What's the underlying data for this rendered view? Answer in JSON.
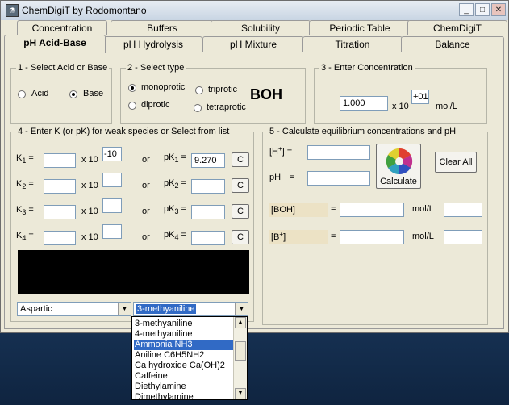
{
  "window": {
    "title": "ChemDigiT by Rodomontano",
    "icon": "app-icon",
    "minimize": "_",
    "maximize": "□",
    "close": "✕"
  },
  "tabs_row1": [
    "Concentration",
    "Buffers",
    "Solubility",
    "Periodic Table",
    "ChemDigiT"
  ],
  "tabs_row2": [
    "pH Acid-Base",
    "pH Hydrolysis",
    "pH Mixture",
    "Titration",
    "Balance"
  ],
  "active_tab": "pH Acid-Base",
  "group1": {
    "title": "1 - Select Acid or Base",
    "acid": "Acid",
    "base": "Base",
    "selected": "Base"
  },
  "group2": {
    "title": "2 - Select type",
    "monoprotic": "monoprotic",
    "triprotic": "triprotic",
    "diprotic": "diprotic",
    "tetraprotic": "tetraprotic",
    "selected": "monoprotic",
    "formula": "BOH"
  },
  "group3": {
    "title": "3 - Enter Concentration",
    "mantissa": "1.000",
    "times10": "x 10",
    "exponent": "+01",
    "unit": "mol/L"
  },
  "group4": {
    "title": "4 - Enter K (or pK) for weak species or Select from list",
    "rows": [
      {
        "k": "K",
        "ksub": "1",
        "eq": "=",
        "times10": "x 10",
        "exp": "-10",
        "or": "or",
        "pk": "pK",
        "pksub": "1",
        "pkval": "9.270",
        "c": "C"
      },
      {
        "k": "K",
        "ksub": "2",
        "eq": "=",
        "times10": "x 10",
        "exp": "",
        "or": "or",
        "pk": "pK",
        "pksub": "2",
        "pkval": "",
        "c": "C"
      },
      {
        "k": "K",
        "ksub": "3",
        "eq": "=",
        "times10": "x 10",
        "exp": "",
        "or": "or",
        "pk": "pK",
        "pksub": "3",
        "pkval": "",
        "c": "C"
      },
      {
        "k": "K",
        "ksub": "4",
        "eq": "=",
        "times10": "x 10",
        "exp": "",
        "or": "or",
        "pk": "pK",
        "pksub": "4",
        "pkval": "",
        "c": "C"
      }
    ],
    "combo_left": "Aspartic",
    "combo_right": "3-methyaniline"
  },
  "group5": {
    "title": "5 - Calculate equilibrium concentrations and pH",
    "h_label": "[H",
    "h_sup": "+",
    "h_close": "] =",
    "ph_label": "pH",
    "ph_eq": "=",
    "calculate": "Calculate",
    "clear_all": "Clear All",
    "boh_label": "[BOH]",
    "bplus_label": "[B",
    "bplus_sup": "+",
    "bplus_close": "]",
    "eq": "=",
    "unit": "mol/L"
  },
  "dropdown_items": [
    "3-methyaniline",
    "4-methyaniline",
    "Ammonia NH3",
    "Aniline C6H5NH2",
    "Ca hydroxide Ca(OH)2",
    "Caffeine",
    "Diethylamine",
    "Dimethylamine"
  ],
  "dropdown_selected": "Ammonia NH3"
}
